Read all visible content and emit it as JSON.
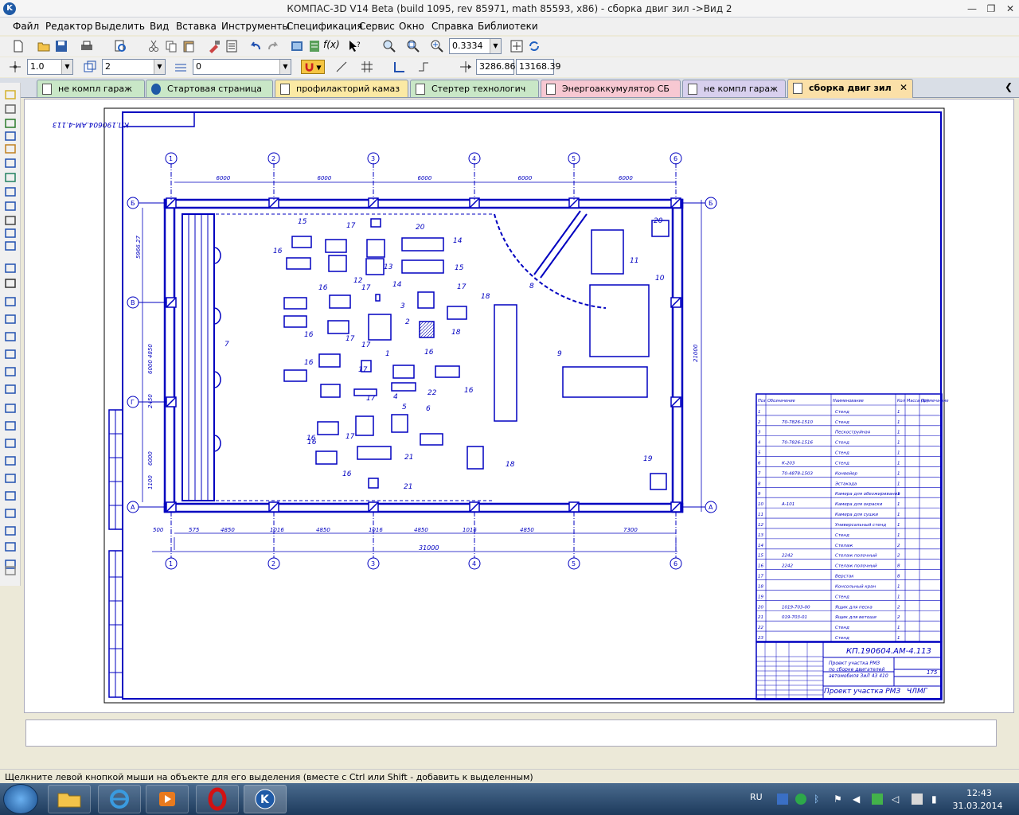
{
  "window": {
    "title": "КОМПАС-3D V14 Beta (build 1095, rev 85971, math 85593, x86) - сборка двиг зил ->Вид 2",
    "minimize": "—",
    "restore": "❐",
    "close": "✕"
  },
  "menu": [
    "Файл",
    "Редактор",
    "Выделить",
    "Вид",
    "Вставка",
    "Инструменты",
    "Спецификация",
    "Сервис",
    "Окно",
    "Справка",
    "Библиотеки"
  ],
  "toolbar": {
    "zoom_value": "0.3334",
    "line_scale": "1.0",
    "layer_value": "2",
    "style_value": "0",
    "coord_x": "3286.868",
    "coord_y": "13168.39",
    "fx_label": "f(x)"
  },
  "tabs": [
    {
      "label": "не компл гараж",
      "color": "#c9e7c7"
    },
    {
      "label": "Стартовая страница",
      "color": "#c9e7c7"
    },
    {
      "label": "профилакторий камаз",
      "color": "#fbe9a4"
    },
    {
      "label": "Стертер технологич",
      "color": "#c9e7c7"
    },
    {
      "label": "Энергоаккумулятор СБ",
      "color": "#f7c8d2"
    },
    {
      "label": "не компл гараж",
      "color": "#d8d0ee"
    },
    {
      "label": "сборка двиг зил",
      "color": "#fbe0a8"
    }
  ],
  "drawing": {
    "stamp_code": "КП.190604.АМ-4.113",
    "title_code": "КП.190604.АМ-4.113",
    "project_desc_1": "Проект участка РМЗ",
    "project_desc_2": "по сборке двигателей",
    "project_desc_3": "автомобиля ЗиЛ 43 410",
    "project_name": "Проект участка РМЗ",
    "org": "ЧЛМГ",
    "sheet_total": "175",
    "top_dims": [
      "6000",
      "6000",
      "6000",
      "6000",
      "6000"
    ],
    "bottom_dims": [
      "500",
      "575",
      "4850",
      "1016",
      "4850",
      "1016",
      "4850",
      "1016",
      "4850",
      "7300"
    ],
    "total_dim": "31000",
    "right_dim": "21000",
    "left_dims": [
      "5966.27",
      "4850",
      "6000",
      "6000",
      "2450",
      "1100"
    ],
    "col_axes": [
      "1",
      "2",
      "3",
      "4",
      "5",
      "6"
    ],
    "row_axes": [
      "Б",
      "В",
      "Г",
      "А"
    ],
    "equipment": [
      "1",
      "2",
      "3",
      "4",
      "5",
      "6",
      "7",
      "8",
      "9",
      "10",
      "11",
      "12",
      "13",
      "14",
      "14",
      "15",
      "15",
      "16",
      "16",
      "16",
      "16",
      "16",
      "16",
      "16",
      "16",
      "16",
      "17",
      "17",
      "17",
      "17",
      "17",
      "17",
      "17",
      "17",
      "18",
      "18",
      "18",
      "19",
      "20",
      "20",
      "21",
      "21",
      "22",
      "23"
    ],
    "spec_headers": [
      "Поз",
      "Обозначение",
      "Наименование",
      "Кол",
      "Масса (кг)",
      "Примеча-ние"
    ],
    "spec_rows": [
      [
        "1",
        "",
        "Стенд",
        "1"
      ],
      [
        "2",
        "70-7826-1510",
        "Стенд",
        "1"
      ],
      [
        "3",
        "",
        "Пескоструйная",
        "1"
      ],
      [
        "4",
        "70-7826-1516",
        "Стенд",
        "1"
      ],
      [
        "5",
        "",
        "Стенд",
        "1"
      ],
      [
        "6",
        "К-203",
        "Стенд",
        "1"
      ],
      [
        "7",
        "70-4878-1503",
        "Конвейер",
        "1"
      ],
      [
        "8",
        "",
        "Эстакада",
        "1"
      ],
      [
        "9",
        "",
        "Камера для обезжиривания",
        "1"
      ],
      [
        "10",
        "А-101",
        "Камера для окраски",
        "1"
      ],
      [
        "11",
        "",
        "Камера для сушки",
        "1"
      ],
      [
        "12",
        "",
        "Универсальный стенд",
        "1"
      ],
      [
        "13",
        "",
        "Стенд",
        "1"
      ],
      [
        "14",
        "",
        "Стелаж",
        "2"
      ],
      [
        "15",
        "2242",
        "Стелаж полочный",
        "2"
      ],
      [
        "16",
        "2242",
        "Стелаж полочный",
        "8"
      ],
      [
        "17",
        "",
        "Верстак",
        "8"
      ],
      [
        "18",
        "",
        "Консольный кран",
        "1"
      ],
      [
        "19",
        "",
        "Стенд",
        "1"
      ],
      [
        "20",
        "1019-703-00",
        "Ящик для песка",
        "2"
      ],
      [
        "21",
        "019-703-01",
        "Ящик для ветоши",
        "2"
      ],
      [
        "22",
        "",
        "Стенд",
        "1"
      ],
      [
        "23",
        "",
        "Стенд",
        "1"
      ]
    ]
  },
  "status": {
    "hint": "Щелкните левой кнопкой мыши на объекте для его выделения (вместе с Ctrl или Shift - добавить к выделенным)"
  },
  "taskbar": {
    "lang": "RU",
    "time": "12:43",
    "date": "31.03.2014"
  },
  "icons": {
    "app": "kompas-logo-icon",
    "start": "windows-start-icon"
  }
}
